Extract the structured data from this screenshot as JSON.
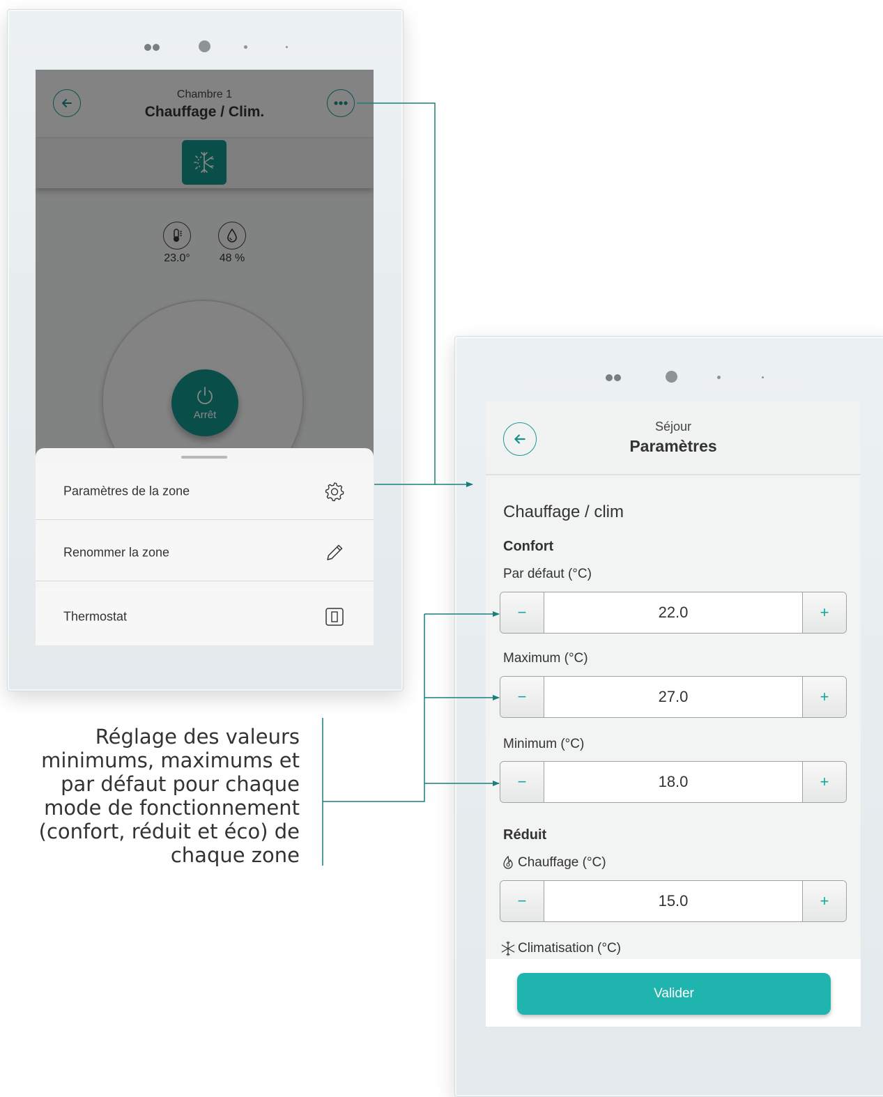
{
  "colors": {
    "accent": "#14938d",
    "accent_button": "#1fb5ae",
    "connector": "#1a7f7a"
  },
  "zone_screen": {
    "header_subtitle": "Chambre 1",
    "header_title": "Chauffage / Clim.",
    "back_icon": "arrow-left-icon",
    "more_icon": "ellipsis-icon",
    "mode_icon": "heat-cool-icon",
    "temperature": "23.0°",
    "humidity": "48 %",
    "power_label": "Arrêt",
    "menu": [
      {
        "label": "Paramètres de la zone",
        "icon": "gear-icon"
      },
      {
        "label": "Renommer la zone",
        "icon": "pencil-icon"
      },
      {
        "label": "Thermostat",
        "icon": "thermostat-icon"
      }
    ]
  },
  "settings_screen": {
    "header_subtitle": "Séjour",
    "header_title": "Paramètres",
    "section_title": "Chauffage / clim",
    "confort_title": "Confort",
    "fields": [
      {
        "label": "Par défaut (°C)",
        "value": "22.0"
      },
      {
        "label": "Maximum (°C)",
        "value": "27.0"
      },
      {
        "label": "Minimum (°C)",
        "value": "18.0"
      }
    ],
    "reduit_title": "Réduit",
    "reduit_fields": [
      {
        "label": "Chauffage (°C)",
        "value": "15.0",
        "icon": "flame-icon"
      },
      {
        "label": "Climatisation (°C)",
        "icon": "snowflake-icon"
      }
    ],
    "minus_label": "−",
    "plus_label": "+",
    "validate_label": "Valider"
  },
  "caption": "Réglage des valeurs minimums, maximums et par défaut pour chaque mode de fonctionnement (confort, réduit et éco) de chaque zone"
}
